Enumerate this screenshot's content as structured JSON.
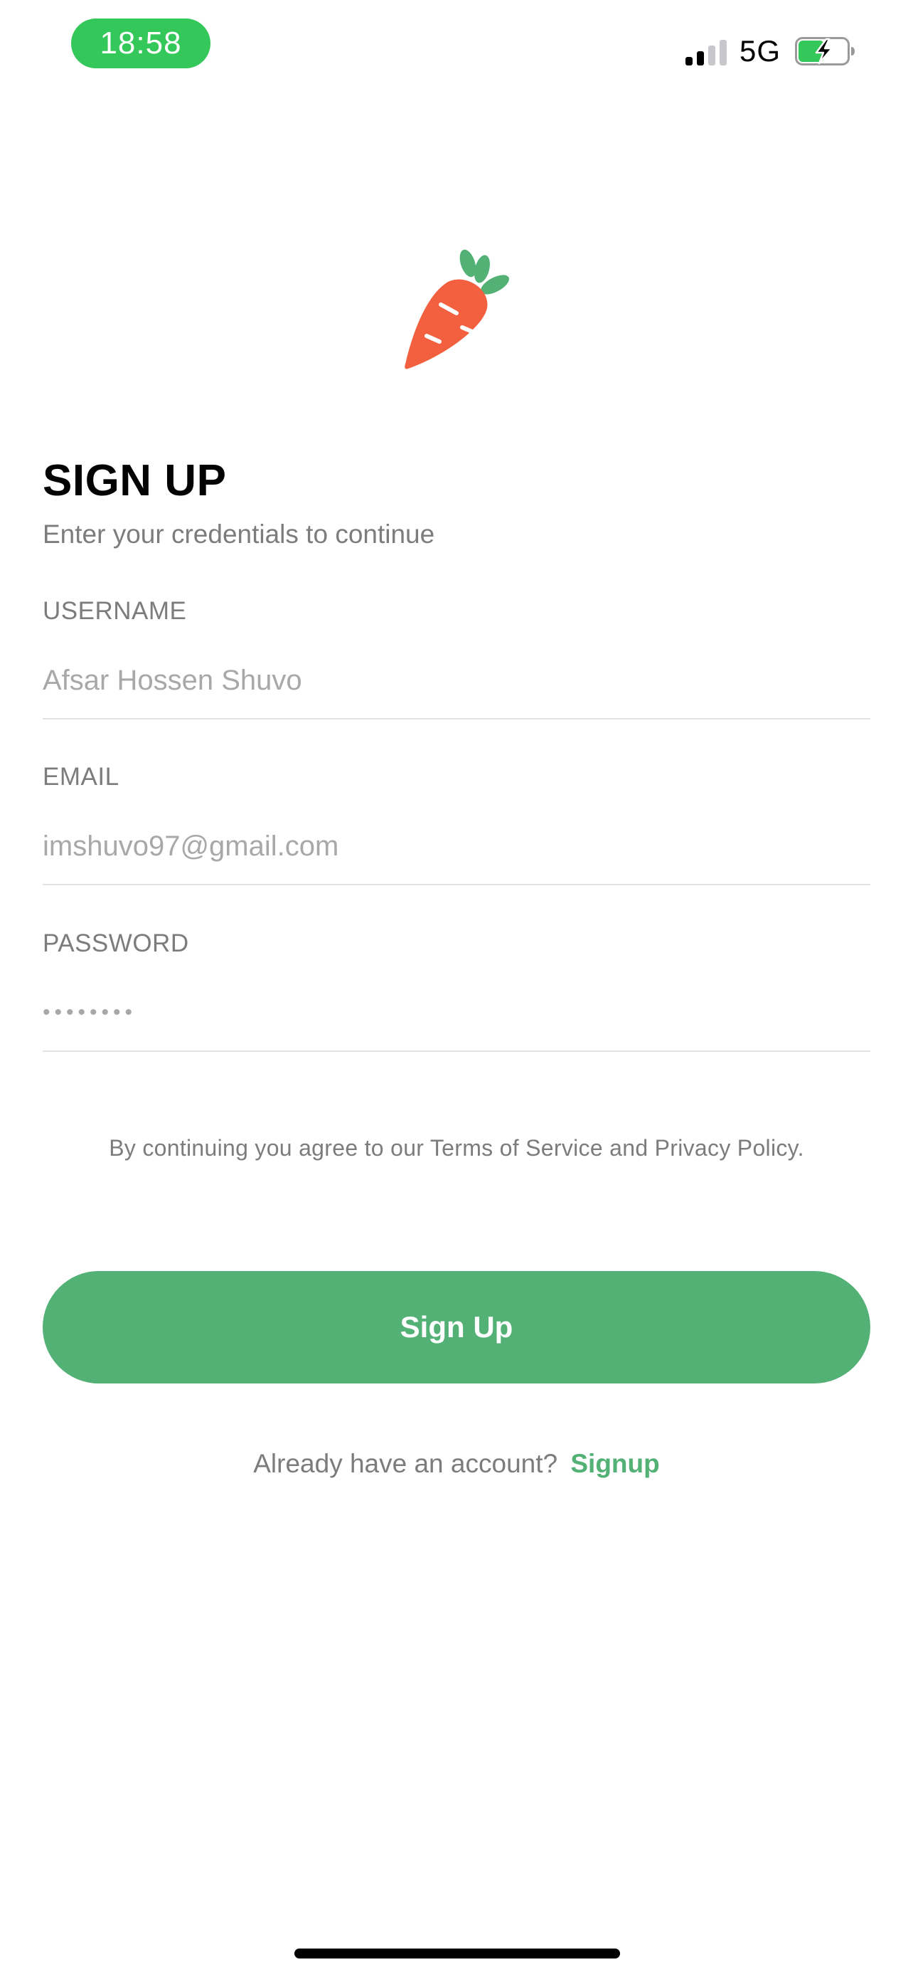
{
  "status_bar": {
    "time": "18:58",
    "network": "5G",
    "signal_icon": "cellular-signal-icon",
    "battery_icon": "battery-charging-icon"
  },
  "logo": {
    "icon": "carrot-icon",
    "colors": {
      "body": "#f3603f",
      "leaves": "#53b175"
    }
  },
  "header": {
    "title": "SIGN UP",
    "subtitle": "Enter your credentials to continue"
  },
  "form": {
    "username": {
      "label": "USERNAME",
      "placeholder": "Afsar Hossen Shuvo"
    },
    "email": {
      "label": "EMAIL",
      "placeholder": "imshuvo97@gmail.com"
    },
    "password": {
      "label": "PASSWORD",
      "value": "••••••••"
    }
  },
  "terms_text": "By continuing you agree to our Terms of Service and Privacy Policy.",
  "signup_button": {
    "label": "Sign Up"
  },
  "account_prompt": {
    "text": "Already have an account?",
    "link": "Signup"
  },
  "colors": {
    "accent": "#53b175",
    "status_pill": "#34c759",
    "muted_text": "#7c7c7c"
  }
}
